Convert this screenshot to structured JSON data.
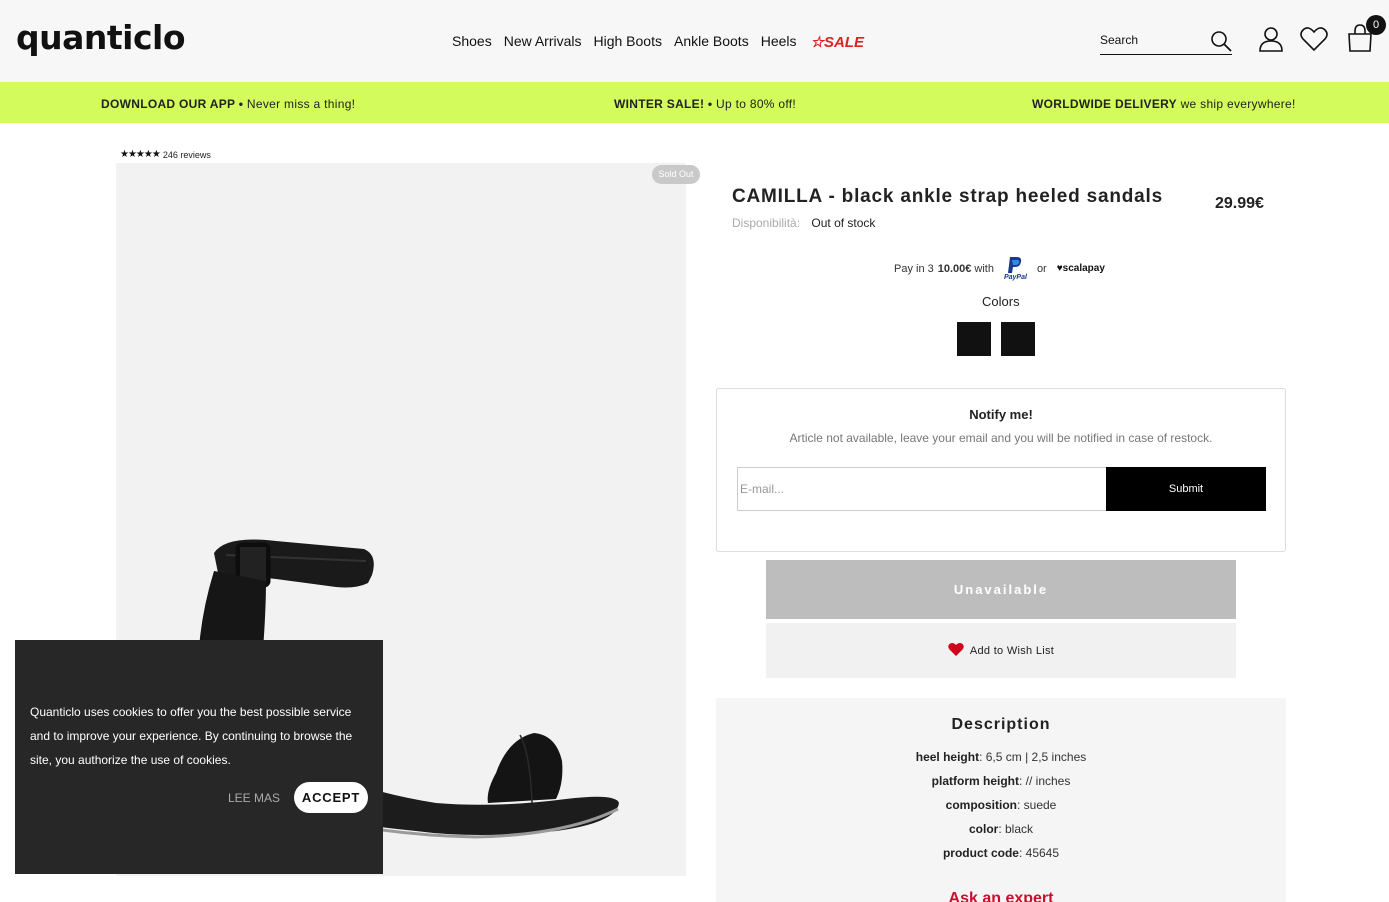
{
  "header": {
    "logo": "quanticlo",
    "nav": [
      "Shoes",
      "New Arrivals",
      "High Boots",
      "Ankle Boots",
      "Heels"
    ],
    "sale": "☆SALE",
    "search_placeholder": "Search",
    "cart_count": "0"
  },
  "promo": {
    "left_bold": "DOWNLOAD OUR APP •",
    "left_text": " Never miss a thing!",
    "mid_bold": "WINTER SALE! •",
    "mid_text": " Up to 80% off!",
    "right_bold": "WORLDWIDE DELIVERY",
    "right_text": " we ship everywhere!"
  },
  "reviews": {
    "stars": "★★★★★",
    "text": "246 reviews"
  },
  "product": {
    "badge": "Sold Out",
    "title": "CAMILLA - black ankle strap heeled sandals",
    "price": "29.99€",
    "availability_label": "Disponibilità:",
    "availability_value": "Out of stock",
    "pay_prefix": "Pay in 3",
    "pay_amount": "10.00€",
    "pay_with": "with",
    "pay_or": "or",
    "paypal": "PayPal",
    "scalapay": "♥scalapay",
    "colors_label": "Colors",
    "swatch_color": "#111111"
  },
  "notify": {
    "title": "Notify me!",
    "text": "Article not available, leave your email and you will be notified in case of restock.",
    "placeholder": "E-mail...",
    "submit": "Submit"
  },
  "buttons": {
    "unavailable": "Unavailable",
    "wishlist": "Add to Wish List"
  },
  "description": {
    "title": "Description",
    "items": [
      {
        "key": "heel height",
        "value": ": 6,5 cm | 2,5 inches"
      },
      {
        "key": "platform height",
        "value": ": // inches"
      },
      {
        "key": "composition",
        "value": ": suede"
      },
      {
        "key": "color",
        "value": ": black"
      },
      {
        "key": "product code",
        "value": ": 45645"
      }
    ],
    "expert": "Ask an expert"
  },
  "cookie": {
    "text": "Quanticlo uses cookies to offer you the best possible service and to improve your experience. By continuing to browse the site, you authorize the use of cookies.",
    "more": "LEE MAS",
    "accept": "ACCEPT"
  }
}
